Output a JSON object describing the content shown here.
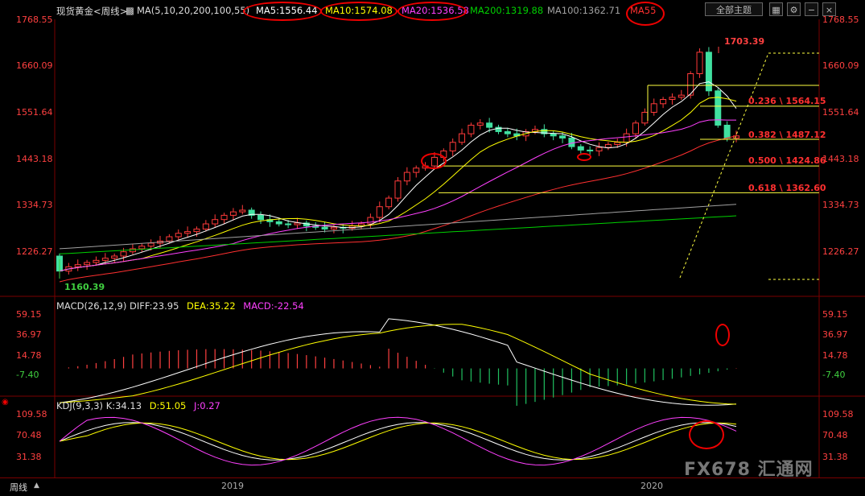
{
  "header": {
    "symbol": "现货黄金<周线>",
    "ma_label": "MA(5,10,20,200,100,55)",
    "ma5": "MA5:1556.44",
    "ma10": "MA10:1574.08",
    "ma20": "MA20:1536.58",
    "ma200": "MA200:1319.88",
    "ma100": "MA100:1362.71",
    "ma55": "MA55",
    "theme_button": "全部主题",
    "colors": {
      "ma5": "#ffffff",
      "ma10": "#ffff00",
      "ma20": "#ff40ff",
      "ma200": "#00d000",
      "ma100": "#a0a0a0",
      "ma55": "#ff3030"
    }
  },
  "main_axis": {
    "labels": [
      "1768.55",
      "1660.09",
      "1551.64",
      "1443.18",
      "1334.73",
      "1226.27"
    ],
    "values": [
      1768.55,
      1660.09,
      1551.64,
      1443.18,
      1334.73,
      1226.27
    ]
  },
  "annotations": {
    "high": "1703.39",
    "low": "1160.39",
    "fib": [
      {
        "label": "0.236 \\ 1564.15",
        "value": 1564.15
      },
      {
        "label": "0.382 \\ 1487.12",
        "value": 1487.12
      },
      {
        "label": "0.500 \\ 1424.86",
        "value": 1424.86
      },
      {
        "label": "0.618 \\ 1362.60",
        "value": 1362.6
      }
    ]
  },
  "macd": {
    "label": "MACD(26,12,9)",
    "diff": "DIFF:23.95",
    "dea": "DEA:35.22",
    "macd": "MACD:-22.54",
    "axis_labels": [
      "59.15",
      "36.97",
      "14.78",
      "-7.40"
    ],
    "axis_values": [
      59.15,
      36.97,
      14.78,
      -7.4
    ]
  },
  "kdj": {
    "label": "KDJ(9,3,3)",
    "k": "K:34.13",
    "d": "D:51.05",
    "j": "J:0.27",
    "axis_labels": [
      "109.58",
      "70.48",
      "31.38"
    ],
    "axis_values": [
      109.58,
      70.48,
      31.38
    ]
  },
  "footer": {
    "period": "周线",
    "x_labels": [
      "2019",
      "2020"
    ],
    "watermark": "FX678 汇通网"
  },
  "chart_data": {
    "type": "candlestick",
    "title": "现货黄金<周线>",
    "ylim": [
      1150,
      1790
    ],
    "series_close": [
      1180,
      1190,
      1195,
      1200,
      1205,
      1210,
      1215,
      1225,
      1232,
      1238,
      1245,
      1250,
      1260,
      1268,
      1272,
      1278,
      1290,
      1300,
      1310,
      1318,
      1322,
      1310,
      1300,
      1295,
      1290,
      1288,
      1292,
      1285,
      1282,
      1278,
      1282,
      1280,
      1285,
      1290,
      1305,
      1330,
      1350,
      1390,
      1410,
      1420,
      1425,
      1445,
      1460,
      1480,
      1500,
      1520,
      1525,
      1515,
      1505,
      1500,
      1495,
      1505,
      1510,
      1500,
      1495,
      1490,
      1470,
      1462,
      1460,
      1468,
      1475,
      1480,
      1500,
      1525,
      1550,
      1570,
      1580,
      1585,
      1590,
      1640,
      1690,
      1600,
      1520,
      1490,
      1495
    ]
  }
}
